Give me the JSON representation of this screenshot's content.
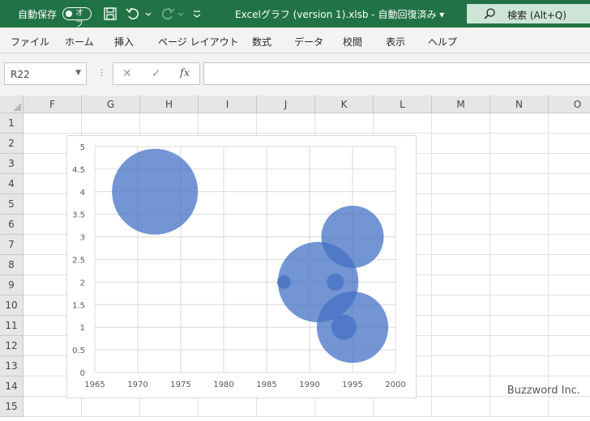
{
  "titlebar": {
    "autosave_label": "自動保存",
    "autosave_state": "オフ",
    "document_title": "Excelグラフ (version 1).xlsb  -  自動回復済み  ▾",
    "search_label": "検索 (Alt+Q)"
  },
  "menu": [
    "ファイル",
    "ホーム",
    "挿入",
    "ページ レイアウト",
    "数式",
    "データ",
    "校閲",
    "表示",
    "ヘルプ"
  ],
  "formula_bar": {
    "name_box": "R22",
    "cancel_symbol": "✕",
    "enter_symbol": "✓",
    "fx_symbol": "fx",
    "formula": ""
  },
  "columns": [
    "F",
    "G",
    "H",
    "I",
    "J",
    "K",
    "L",
    "M",
    "N",
    "O"
  ],
  "rows": [
    "1",
    "2",
    "3",
    "4",
    "5",
    "6",
    "7",
    "8",
    "9",
    "10",
    "11",
    "12",
    "13",
    "14",
    "15"
  ],
  "chart_data": {
    "type": "bubble",
    "xlim": [
      1965,
      2000
    ],
    "ylim": [
      0,
      5
    ],
    "x_ticks": [
      "1965",
      "1970",
      "1975",
      "1980",
      "1985",
      "1990",
      "1995",
      "2000"
    ],
    "y_ticks": [
      "0",
      "0.5",
      "1",
      "1.5",
      "2",
      "2.5",
      "3",
      "3.5",
      "4",
      "4.5",
      "5"
    ],
    "grid": true,
    "bubble_color": "#4472C4",
    "points": [
      {
        "x": 1972,
        "y": 4,
        "r": 0.95
      },
      {
        "x": 1995,
        "y": 3,
        "r": 0.69
      },
      {
        "x": 1991,
        "y": 2,
        "r": 0.89
      },
      {
        "x": 1987,
        "y": 2,
        "r": 0.15
      },
      {
        "x": 1993,
        "y": 2,
        "r": 0.19
      },
      {
        "x": 1995,
        "y": 1,
        "r": 0.79
      },
      {
        "x": 1994,
        "y": 1,
        "r": 0.28
      }
    ]
  },
  "watermark": "Buzzword Inc."
}
